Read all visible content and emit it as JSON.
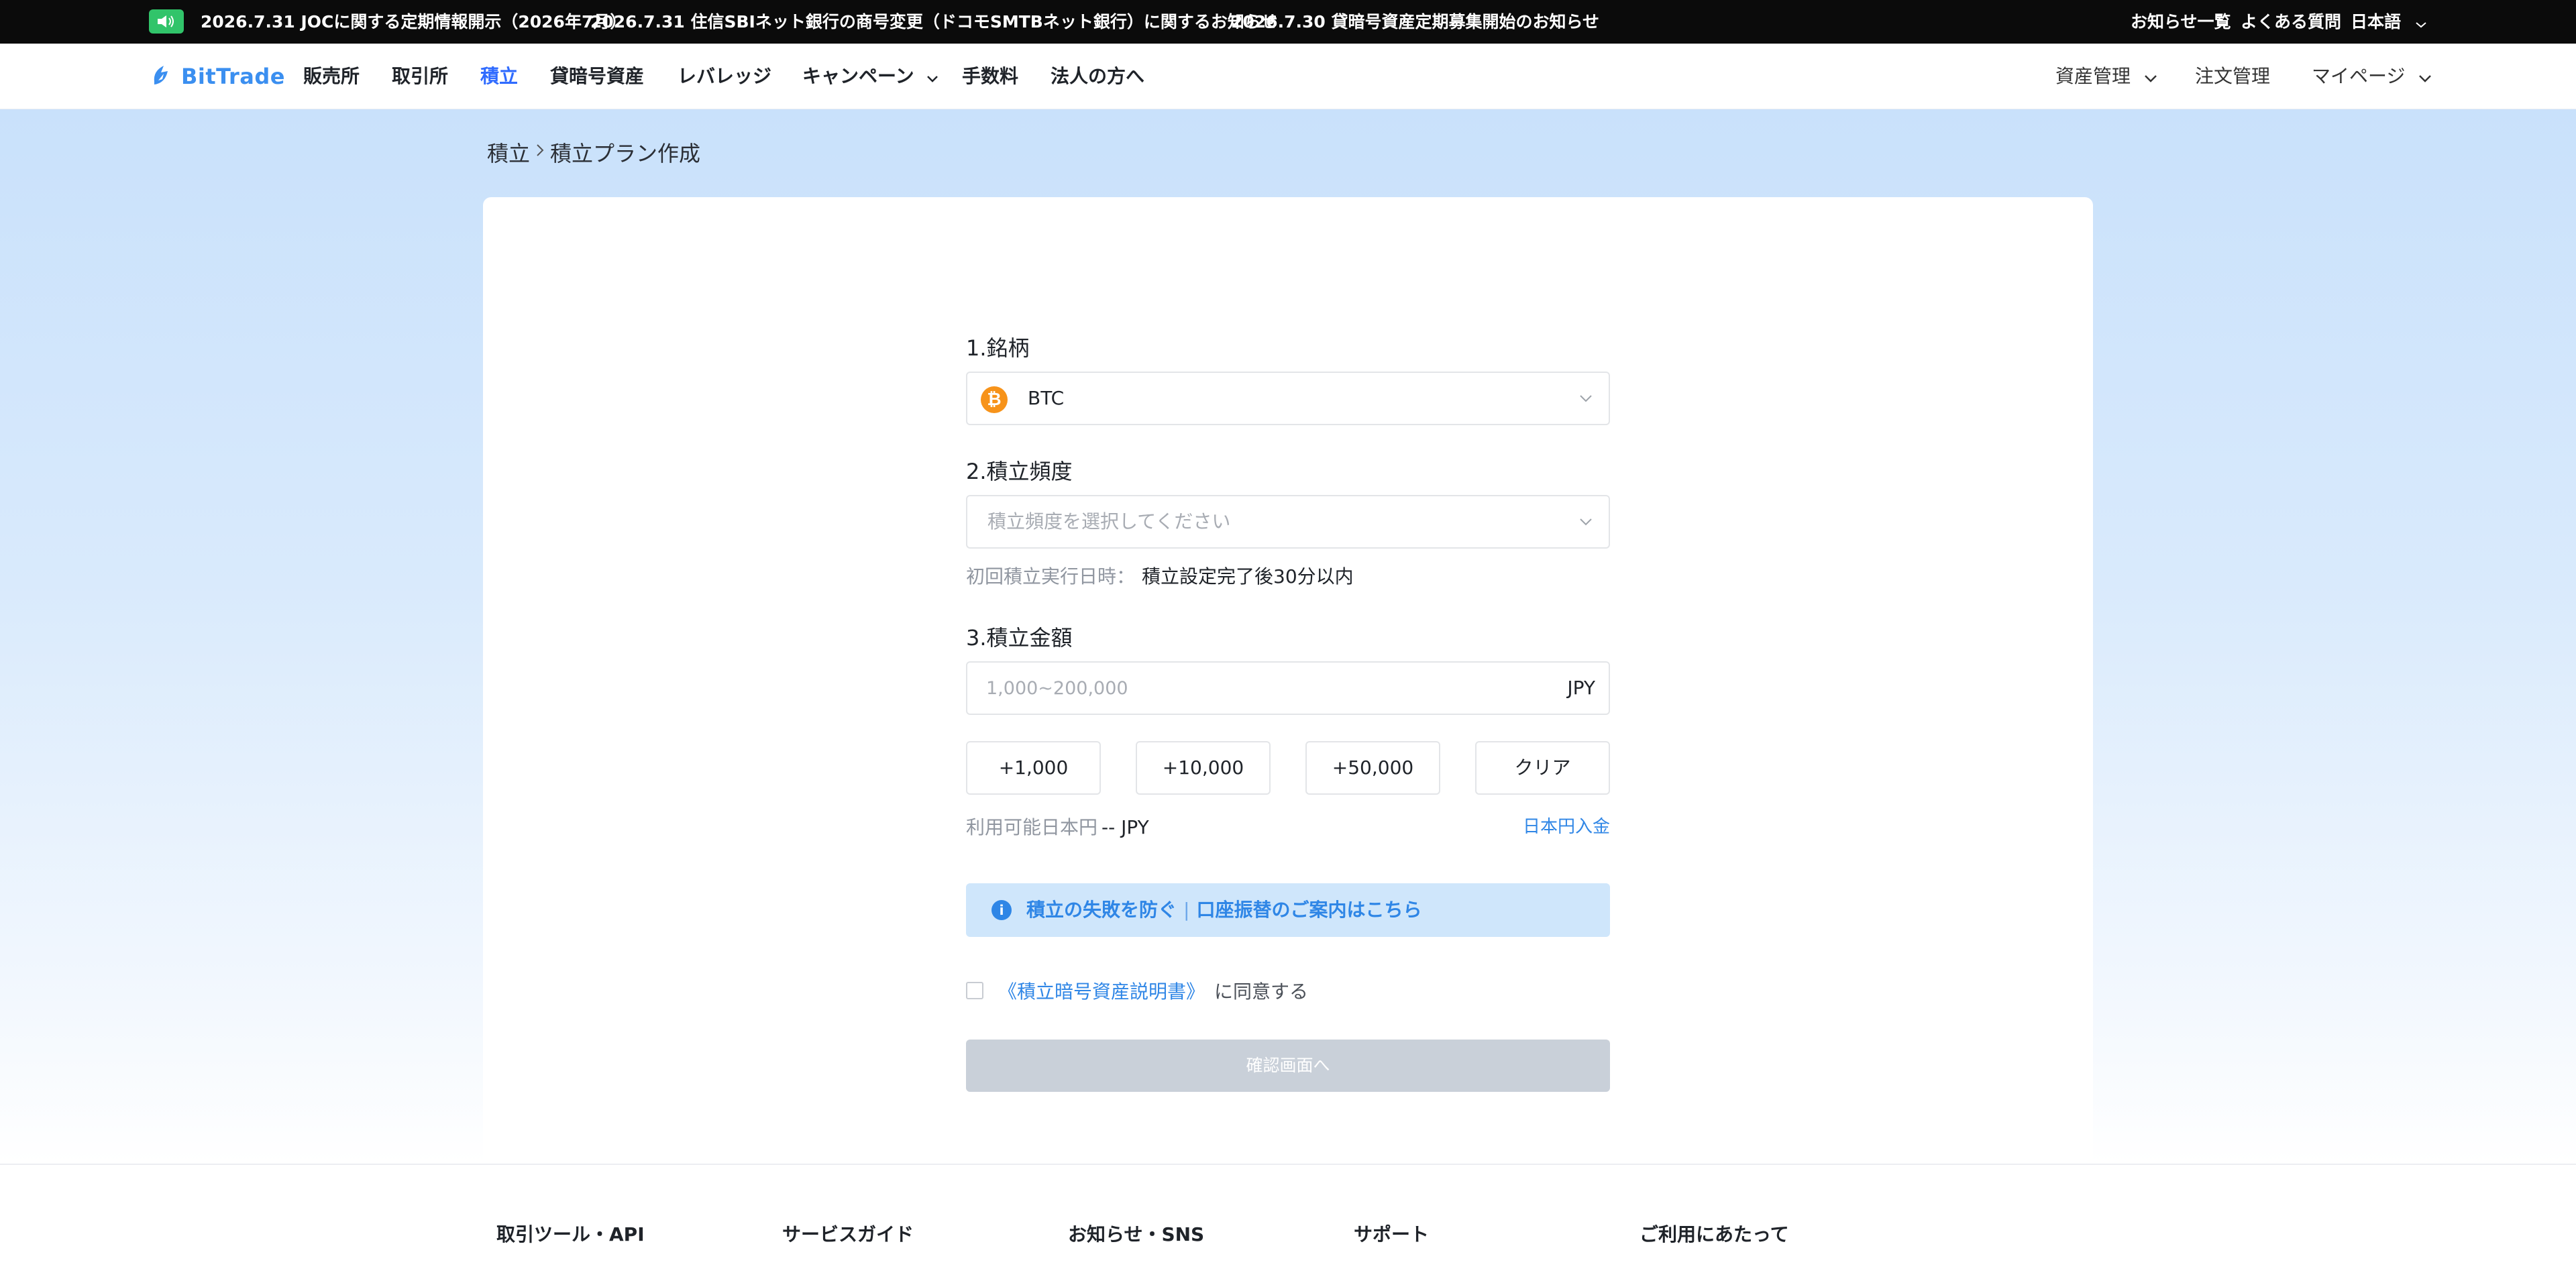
{
  "announcements": {
    "items": [
      "2026.7.31 JOCに関する定期情報開示（2026年7月）",
      "2026.7.31 住信SBIネット銀行の商号変更（ドコモSMTBネット銀行）に関するお知らせ",
      "2026.7.30 貸暗号資産定期募集開始のお知らせ"
    ],
    "right_links": [
      "お知らせ一覧",
      "よくある質問"
    ],
    "language": "日本語"
  },
  "nav": {
    "logo": "BitTrade",
    "items": [
      "販売所",
      "取引所",
      "積立",
      "貸暗号資産",
      "レバレッジ",
      "キャンペーン",
      "手数料",
      "法人の方へ"
    ],
    "active_item": "積立",
    "right": {
      "asset_mgmt": "資産管理",
      "orders": "注文管理",
      "mypage": "マイページ"
    }
  },
  "breadcrumb": {
    "parent": "積立",
    "current": "積立プラン作成"
  },
  "form": {
    "symbol": {
      "label": "1.銘柄",
      "value": "BTC",
      "icon": "bitcoin-icon",
      "icon_glyph": "₿"
    },
    "frequency": {
      "label": "2.積立頻度",
      "placeholder": "積立頻度を選択してください"
    },
    "first_execution": {
      "key": "初回積立実行日時：",
      "value": "積立設定完了後30分以内"
    },
    "amount": {
      "label": "3.積立金額",
      "placeholder": "1,000~200,000",
      "unit": "JPY"
    },
    "quick_buttons": [
      "+1,000",
      "+10,000",
      "+50,000",
      "クリア"
    ],
    "available": {
      "key": "利用可能日本円",
      "value": "-- JPY"
    },
    "deposit_link": "日本円入金",
    "notice": {
      "part1": "積立の失敗を防ぐ",
      "separator": "|",
      "part2": "口座振替のご案内はこちら"
    },
    "agreement": {
      "doc": "《積立暗号資産説明書》",
      "text": "に同意する"
    },
    "confirm_button": "確認画面へ"
  },
  "footer": {
    "columns": [
      "取引ツール・API",
      "サービスガイド",
      "お知らせ・SNS",
      "サポート",
      "ご利用にあたって"
    ]
  },
  "colors": {
    "accent": "#2f86e6",
    "nav_active": "#2f6bff",
    "bitcoin": "#f7931a",
    "speaker": "#31c46a",
    "disabled_button": "#c9d0d9"
  }
}
